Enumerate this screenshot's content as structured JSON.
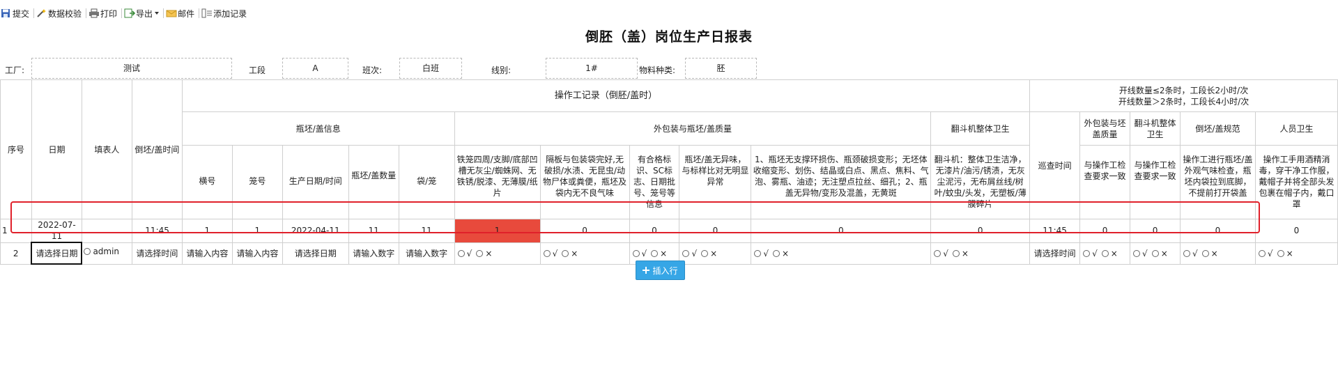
{
  "toolbar": {
    "items": [
      {
        "label": "提交",
        "icon": "save-icon"
      },
      {
        "label": "数据校验",
        "icon": "check-wand-icon"
      },
      {
        "label": "打印",
        "icon": "printer-icon"
      },
      {
        "label": "导出",
        "icon": "export-icon"
      },
      {
        "label": "邮件",
        "icon": "mail-icon"
      },
      {
        "label": "添加记录",
        "icon": "add-record-icon"
      }
    ]
  },
  "report_title": "倒胚（盖）岗位生产日报表",
  "meta": {
    "factory_label": "工厂:",
    "factory_value": "测试",
    "section_label": "工段",
    "section_value": "A",
    "shift_label": "班次:",
    "shift_value": "白班",
    "line_label": "线别:",
    "line_value": "1#",
    "material_label": "物料种类:",
    "material_value": "胚"
  },
  "headers": {
    "seq": "序号",
    "date": "日期",
    "filler": "填表人",
    "pour_time": "倒坯/盖时间",
    "op_record": "操作工记录（倒胚/盖时）",
    "inspection_note_1": "开线数量≤2条时，工段长2小时/次",
    "inspection_note_2": "开线数量＞2条时，工段长4小时/次",
    "bottle_info": "瓶坯/盖信息",
    "package_quality": "外包装与瓶坯/盖质量",
    "flipper_hygiene": "翻斗机整体卫生",
    "patrol_time": "巡查时间",
    "pkg_quality_short": "外包装与坯盖质量",
    "flipper_hygiene_short": "翻斗机整体卫生",
    "pour_spec": "倒坯/盖规范",
    "staff_hygiene": "人员卫生",
    "batch_no": "横号",
    "cage_no": "笼号",
    "prod_datetime": "生产日期/时间",
    "bottle_qty": "瓶坯/盖数量",
    "bag_cage": "袋/笼",
    "crit_cage": "铁笼四周/支脚/底部凹槽无灰尘/蜘蛛网、无铁锈/脱漆、无薄膜/纸片",
    "crit_partition": "隔板与包装袋完好,无破损/水渍、无昆虫/动物尸体或粪便，瓶坯及袋内无不良气味",
    "crit_label": "有合格标识、SC标志、日期批号、笼号等信息",
    "crit_odor": "瓶坯/盖无异味，与标样比对无明显异常",
    "crit_defects": "1、瓶坯无支撑环损伤、瓶颈破损变形；无坯体收缩变形、划伤、结晶或白点、黑点、焦料、气泡、雾瓶、油迹；无注塑点拉丝、细孔；2、瓶盖无异物/变形及混盖，无黄斑",
    "crit_flipper": "翻斗机：整体卫生洁净，无漆片/油污/锈渍，无灰尘泥污，无布屑丝线/树叶/蚊虫/头发，无塑板/薄膜碎片",
    "crit_pkg_check": "与操作工检查要求一致",
    "crit_flip_check": "与操作工检查要求一致",
    "crit_spec": "操作工进行瓶坯/盖外观气味检查，瓶坯内袋拉到底脚，不提前打开袋盖",
    "crit_staff": "操作工手用酒精消毒，穿干净工作服，戴帽子并将全部头发包裹在帽子内，戴口罩"
  },
  "rows": [
    {
      "seq": "1",
      "date": "2022-07-11",
      "filler": "",
      "pour_time": "11:45",
      "batch_no": "1",
      "cage_no": "1",
      "prod_datetime": "2022-04-11",
      "bottle_qty": "11",
      "bag_cage": "11",
      "c_cage": "1",
      "c_partition": "0",
      "c_label": "0",
      "c_odor": "0",
      "c_defects": "0",
      "c_flipper": "0",
      "patrol_time": "11:45",
      "c_pkg_check": "0",
      "c_flip_check": "0",
      "c_spec": "0",
      "c_staff": "0"
    },
    {
      "seq": "2",
      "filler": "admin",
      "date_placeholder": "请选择日期",
      "time_placeholder": "请选择时间",
      "text_placeholder": "请输入内容",
      "number_placeholder": "请输入数字",
      "ok_symbol": "√",
      "ng_symbol": "×"
    }
  ],
  "insert_row_label": "插入行",
  "colors": {
    "highlight_border": "#e0202a",
    "failed_cell": "#e84a3c",
    "insert_button": "#36a6e6"
  }
}
